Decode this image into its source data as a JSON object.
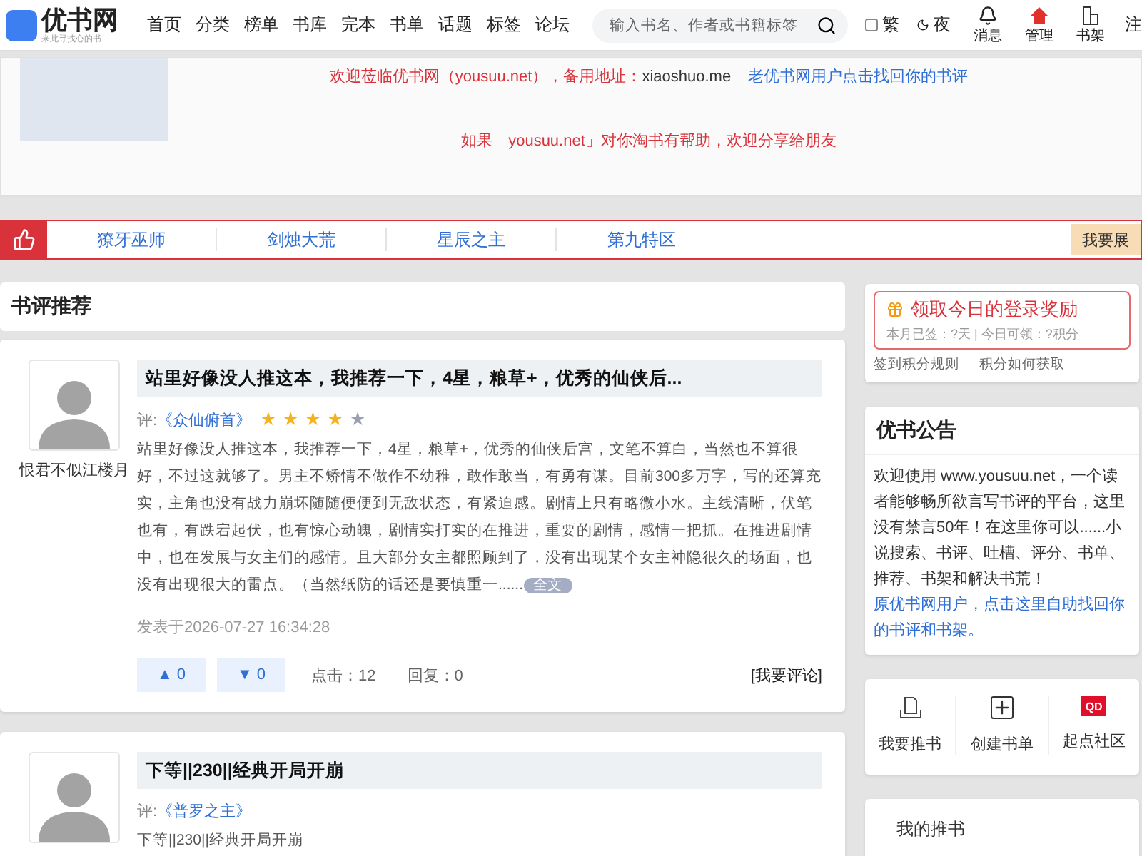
{
  "header": {
    "logo": "优书网",
    "tagline": "来此寻找心的书",
    "nav": [
      "首页",
      "分类",
      "榜单",
      "书库",
      "完本",
      "书单",
      "话题",
      "标签",
      "论坛"
    ],
    "search": {
      "placeholder": "输入书名、作者或书籍标签"
    },
    "toggles": [
      {
        "kind": "traditional",
        "label": "繁"
      },
      {
        "kind": "night",
        "label": "夜"
      }
    ],
    "actions": [
      {
        "kind": "bell",
        "label": "消息"
      },
      {
        "kind": "admin",
        "label": "管理"
      },
      {
        "kind": "shelf",
        "label": "书架"
      },
      {
        "kind": "text",
        "label": "注"
      }
    ]
  },
  "notice": {
    "messages": [
      {
        "kind": "red",
        "text": "欢迎莅临优书网（yousuu.net），备用地址：",
        "extra": "xiaoshuo.me"
      },
      {
        "kind": "blue",
        "text": "老优书网用户点击找回你的书评"
      },
      {
        "kind": "red",
        "text": "如果「yousuu.net」对你淘书有帮助，欢迎分享给朋友"
      }
    ]
  },
  "recommend_bar": {
    "links": [
      "獠牙巫师",
      "剑烛大荒",
      "星辰之主",
      "第九特区"
    ],
    "button": "我要展"
  },
  "reviews_section": {
    "title": "书评推荐",
    "reviews": [
      {
        "user": "恨君不似江楼月",
        "title": "站里好像没人推这本，我推荐一下，4星，粮草+，优秀的仙侠后...",
        "prefix": "评:",
        "book": "《众仙俯首》",
        "stars": 4,
        "body": "站里好像没人推这本，我推荐一下，4星，粮草+，优秀的仙侠后宫，文笔不算白，当然也不算很好，不过这就够了。男主不矫情不做作不幼稚，敢作敢当，有勇有谋。目前300多万字，写的还算充实，主角也没有战力崩坏随随便便到无敌状态，有紧迫感。剧情上只有略微小水。主线清晰，伏笔也有，有跌宕起伏，也有惊心动魄，剧情实打实的在推进，重要的剧情，感情一把抓。在推进剧情中，也在发展与女主们的感情。且大部分女主都照顾到了，没有出现某个女主神隐很久的场面，也没有出现很大的雷点。（当然纸防的话还是要慎重一......",
        "more": "全文",
        "date": "发表于2026-07-27 16:34:28",
        "up_arrow": "▲",
        "up": "0",
        "down_arrow": "▼",
        "down": "0",
        "clicks": "点击：12",
        "replies": "回复：0",
        "comment": "[我要评论]"
      },
      {
        "title": "下等||230||经典开局开崩",
        "prefix": "评:",
        "book": "《普罗之主》",
        "body": "下等||230||经典开局开崩"
      }
    ]
  },
  "sidebar": {
    "signin": {
      "title": "领取今日的登录奖励",
      "stats": "本月已签：?天 | 今日可领：?积分",
      "links": [
        "签到积分规则",
        "积分如何获取"
      ]
    },
    "announcement": {
      "title": "优书公告",
      "text": "欢迎使用 www.yousuu.net，一个读者能够畅所欲言写书评的平台，这里没有禁言50年！在这里你可以......小说搜索、书评、吐槽、评分、书单、推荐、书架和解决书荒！",
      "link": "原优书网用户，点击这里自助找回你的书评和书架。"
    },
    "quick_actions": [
      {
        "kind": "book",
        "label": "我要推书"
      },
      {
        "kind": "plus",
        "label": "创建书单"
      },
      {
        "kind": "qd",
        "label": "起点社区",
        "logo_text": "QD"
      }
    ],
    "my_books": {
      "title": "我的推书"
    }
  }
}
